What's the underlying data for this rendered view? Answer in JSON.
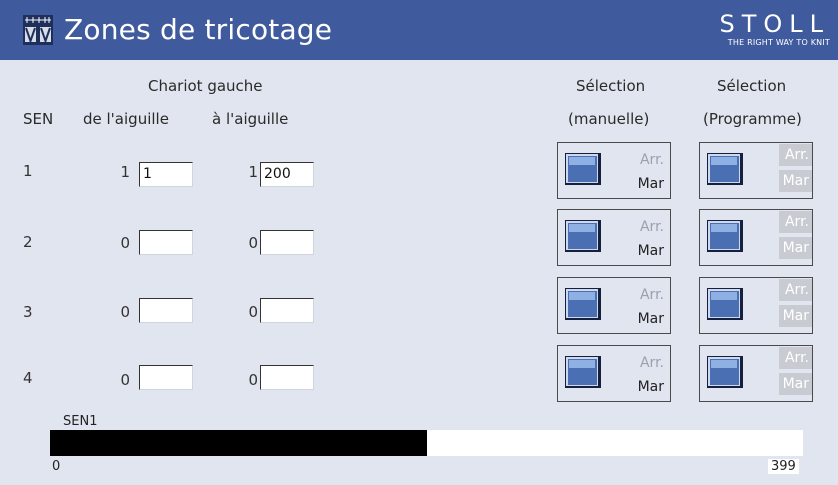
{
  "titlebar": {
    "title": "Zones de tricotage",
    "brand": "STOLL",
    "tagline": "THE RIGHT WAY TO KNIT",
    "icon": "knitting-zones-icon"
  },
  "headers": {
    "chariot": "Chariot gauche",
    "sen": "SEN",
    "from_needle": "de l'aiguille",
    "to_needle": "à l'aiguille",
    "sel_manual_1": "Sélection",
    "sel_manual_2": "(manuelle)",
    "sel_program_1": "Sélection",
    "sel_program_2": "(Programme)"
  },
  "rows": [
    {
      "sen": "1",
      "from_num": "1",
      "from_value": "1",
      "to_num": "1",
      "to_value": "200",
      "manual_off": "Arr.",
      "manual_on": "Mar",
      "prog_off": "Arr.",
      "prog_on": "Mar"
    },
    {
      "sen": "2",
      "from_num": "0",
      "from_value": "",
      "to_num": "0",
      "to_value": "",
      "manual_off": "Arr.",
      "manual_on": "Mar",
      "prog_off": "Arr.",
      "prog_on": "Mar"
    },
    {
      "sen": "3",
      "from_num": "0",
      "from_value": "",
      "to_num": "0",
      "to_value": "",
      "manual_off": "Arr.",
      "manual_on": "Mar",
      "prog_off": "Arr.",
      "prog_on": "Mar"
    },
    {
      "sen": "4",
      "from_num": "0",
      "from_value": "",
      "to_num": "0",
      "to_value": "",
      "manual_off": "Arr.",
      "manual_on": "Mar",
      "prog_off": "Arr.",
      "prog_on": "Mar"
    }
  ],
  "sen_bar": {
    "label": "SEN1",
    "min": "0",
    "max": "399",
    "range_start": 0,
    "range_end": 200
  },
  "colors": {
    "titlebar": "#405a9e",
    "background": "#e1e5ef",
    "button": "#4a6fb3",
    "bar_fill": "#000000"
  }
}
